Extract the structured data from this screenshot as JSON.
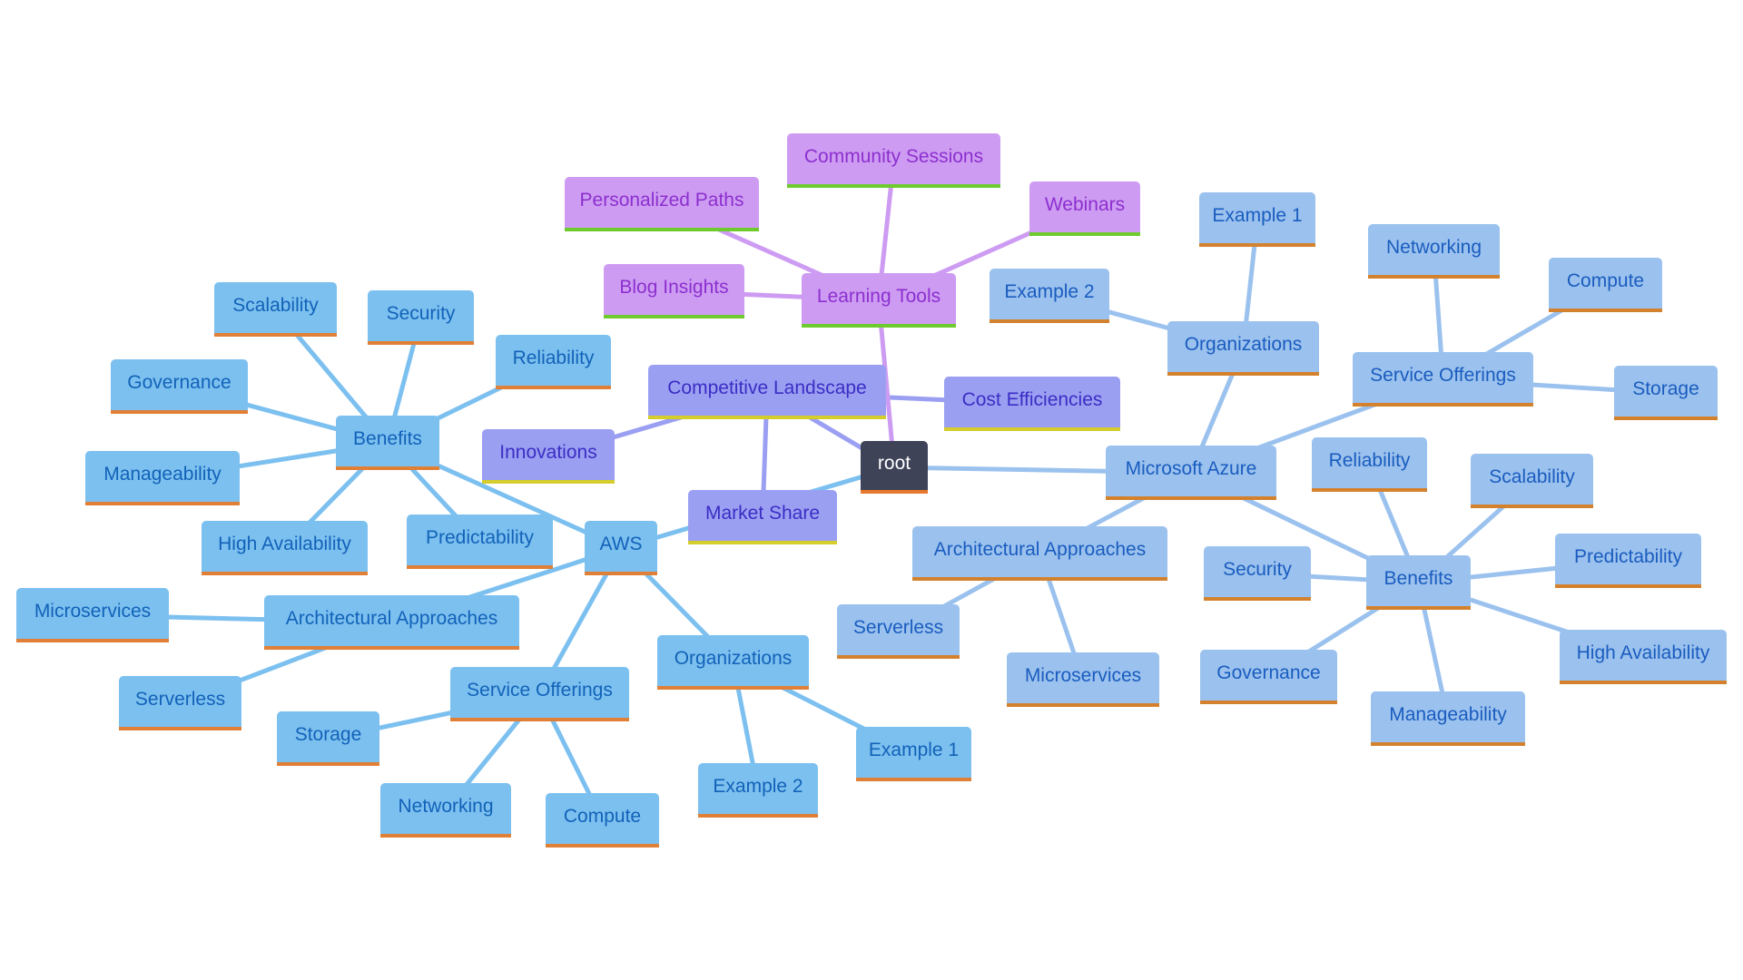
{
  "diagram": {
    "type": "mindmap",
    "colors": {
      "root_fill": "#3f4358",
      "root_text": "#ffffff",
      "root_accent": "#e8772e",
      "competitive_fill": "#9b9ff2",
      "competitive_text": "#3b2ec4",
      "competitive_accent": "#d4cd2c",
      "competitive_edge": "#9b9ff2",
      "learning_fill": "#cd9cf2",
      "learning_text": "#8d2fcf",
      "learning_accent": "#6ecb2e",
      "learning_edge": "#cd9cf2",
      "aws_fill": "#7cc0f0",
      "aws_text": "#1262b8",
      "aws_accent": "#e07f36",
      "aws_edge": "#7cc0f0",
      "azure_fill": "#9bc2ee",
      "azure_text": "#1a5cbf",
      "azure_accent": "#d4812d",
      "azure_edge": "#9bc2ee"
    },
    "nodes": {
      "root": "root",
      "competitive_landscape": "Competitive Landscape",
      "innovations": "Innovations",
      "market_share": "Market Share",
      "cost_efficiencies": "Cost Efficiencies",
      "learning_tools": "Learning Tools",
      "blog_insights": "Blog Insights",
      "personalized_paths": "Personalized Paths",
      "community_sessions": "Community Sessions",
      "webinars": "Webinars",
      "aws": "AWS",
      "aws_benefits": "Benefits",
      "aws_scalability": "Scalability",
      "aws_security": "Security",
      "aws_reliability": "Reliability",
      "aws_governance": "Governance",
      "aws_manageability": "Manageability",
      "aws_high_availability": "High Availability",
      "aws_predictability": "Predictability",
      "aws_arch": "Architectural Approaches",
      "aws_microservices": "Microservices",
      "aws_serverless": "Serverless",
      "aws_services": "Service Offerings",
      "aws_storage": "Storage",
      "aws_networking": "Networking",
      "aws_compute": "Compute",
      "aws_orgs": "Organizations",
      "aws_example2": "Example 2",
      "aws_example1": "Example 1",
      "azure": "Microsoft Azure",
      "az_orgs": "Organizations",
      "az_example1": "Example 1",
      "az_example2": "Example 2",
      "az_services": "Service Offerings",
      "az_networking": "Networking",
      "az_compute": "Compute",
      "az_storage": "Storage",
      "az_arch": "Architectural Approaches",
      "az_serverless": "Serverless",
      "az_microservices": "Microservices",
      "az_benefits": "Benefits",
      "az_reliability": "Reliability",
      "az_scalability": "Scalability",
      "az_security": "Security",
      "az_predictability": "Predictability",
      "az_high_availability": "High Availability",
      "az_governance": "Governance",
      "az_manageability": "Manageability"
    },
    "edges": [
      [
        "root",
        "competitive_landscape",
        "competitive"
      ],
      [
        "competitive_landscape",
        "innovations",
        "competitive"
      ],
      [
        "competitive_landscape",
        "market_share",
        "competitive"
      ],
      [
        "competitive_landscape",
        "cost_efficiencies",
        "competitive"
      ],
      [
        "root",
        "learning_tools",
        "learning"
      ],
      [
        "learning_tools",
        "blog_insights",
        "learning"
      ],
      [
        "learning_tools",
        "personalized_paths",
        "learning"
      ],
      [
        "learning_tools",
        "community_sessions",
        "learning"
      ],
      [
        "learning_tools",
        "webinars",
        "learning"
      ],
      [
        "root",
        "aws",
        "aws"
      ],
      [
        "aws",
        "aws_benefits",
        "aws"
      ],
      [
        "aws_benefits",
        "aws_scalability",
        "aws"
      ],
      [
        "aws_benefits",
        "aws_security",
        "aws"
      ],
      [
        "aws_benefits",
        "aws_reliability",
        "aws"
      ],
      [
        "aws_benefits",
        "aws_governance",
        "aws"
      ],
      [
        "aws_benefits",
        "aws_manageability",
        "aws"
      ],
      [
        "aws_benefits",
        "aws_high_availability",
        "aws"
      ],
      [
        "aws_benefits",
        "aws_predictability",
        "aws"
      ],
      [
        "aws",
        "aws_arch",
        "aws"
      ],
      [
        "aws_arch",
        "aws_microservices",
        "aws"
      ],
      [
        "aws_arch",
        "aws_serverless",
        "aws"
      ],
      [
        "aws",
        "aws_services",
        "aws"
      ],
      [
        "aws_services",
        "aws_storage",
        "aws"
      ],
      [
        "aws_services",
        "aws_networking",
        "aws"
      ],
      [
        "aws_services",
        "aws_compute",
        "aws"
      ],
      [
        "aws",
        "aws_orgs",
        "aws"
      ],
      [
        "aws_orgs",
        "aws_example2",
        "aws"
      ],
      [
        "aws_orgs",
        "aws_example1",
        "aws"
      ],
      [
        "root",
        "azure",
        "azure"
      ],
      [
        "azure",
        "az_orgs",
        "azure"
      ],
      [
        "az_orgs",
        "az_example1",
        "azure"
      ],
      [
        "az_orgs",
        "az_example2",
        "azure"
      ],
      [
        "azure",
        "az_services",
        "azure"
      ],
      [
        "az_services",
        "az_networking",
        "azure"
      ],
      [
        "az_services",
        "az_compute",
        "azure"
      ],
      [
        "az_services",
        "az_storage",
        "azure"
      ],
      [
        "azure",
        "az_arch",
        "azure"
      ],
      [
        "az_arch",
        "az_serverless",
        "azure"
      ],
      [
        "az_arch",
        "az_microservices",
        "azure"
      ],
      [
        "azure",
        "az_benefits",
        "azure"
      ],
      [
        "az_benefits",
        "az_reliability",
        "azure"
      ],
      [
        "az_benefits",
        "az_scalability",
        "azure"
      ],
      [
        "az_benefits",
        "az_security",
        "azure"
      ],
      [
        "az_benefits",
        "az_predictability",
        "azure"
      ],
      [
        "az_benefits",
        "az_high_availability",
        "azure"
      ],
      [
        "az_benefits",
        "az_governance",
        "azure"
      ],
      [
        "az_benefits",
        "az_manageability",
        "azure"
      ]
    ]
  }
}
